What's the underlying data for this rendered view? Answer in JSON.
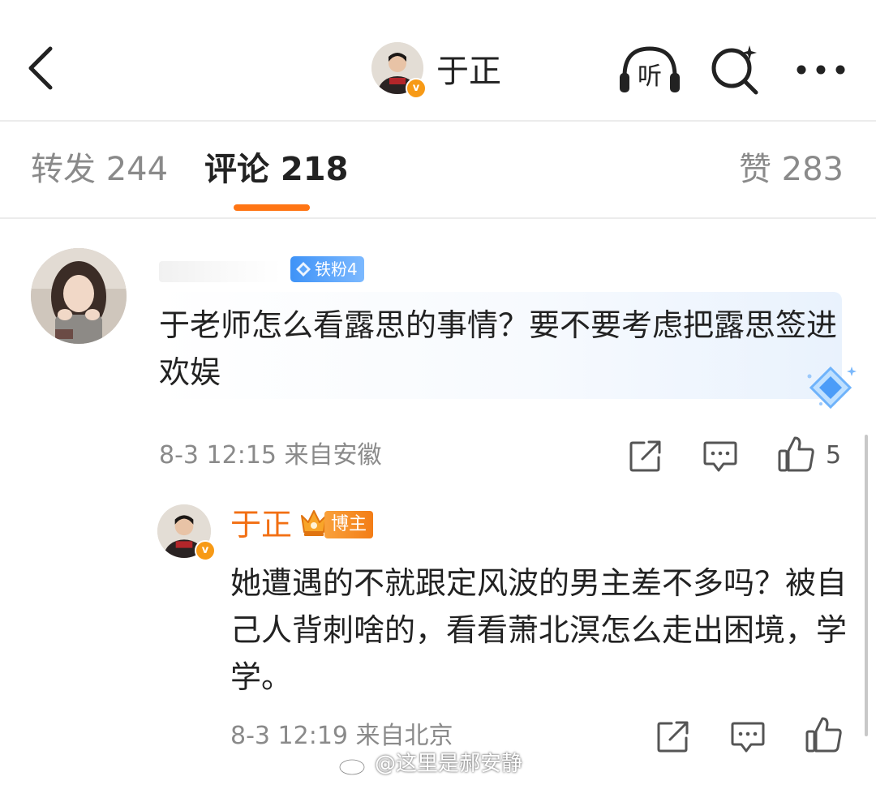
{
  "header": {
    "title": "于正",
    "back_icon": "chevron-left-icon",
    "listen_icon": "headphones-listen-icon",
    "listen_glyph": "听",
    "search_icon": "search-sparkle-icon",
    "more_icon": "more-dots-icon",
    "verified_glyph": "v"
  },
  "tabs": [
    {
      "label": "转发 244",
      "active": false
    },
    {
      "label": "评论 218",
      "active": true
    },
    {
      "label": "赞 283",
      "active": false
    }
  ],
  "accent_color": "#ff7514",
  "comment": {
    "fan_badge": "铁粉4",
    "text": "于老师怎么看露思的事情？要不要考虑把露思签进欢娱",
    "time": "8-3 12:15",
    "location": "来自安徽",
    "like_count": "5"
  },
  "reply": {
    "author": "于正",
    "badge": "博主",
    "text": "她遭遇的不就跟定风波的男主差不多吗？被自己人背刺啥的，看看萧北溟怎么走出困境，学学。",
    "time": "8-3 12:19",
    "location": "来自北京"
  },
  "watermark": "@这里是郝安静"
}
